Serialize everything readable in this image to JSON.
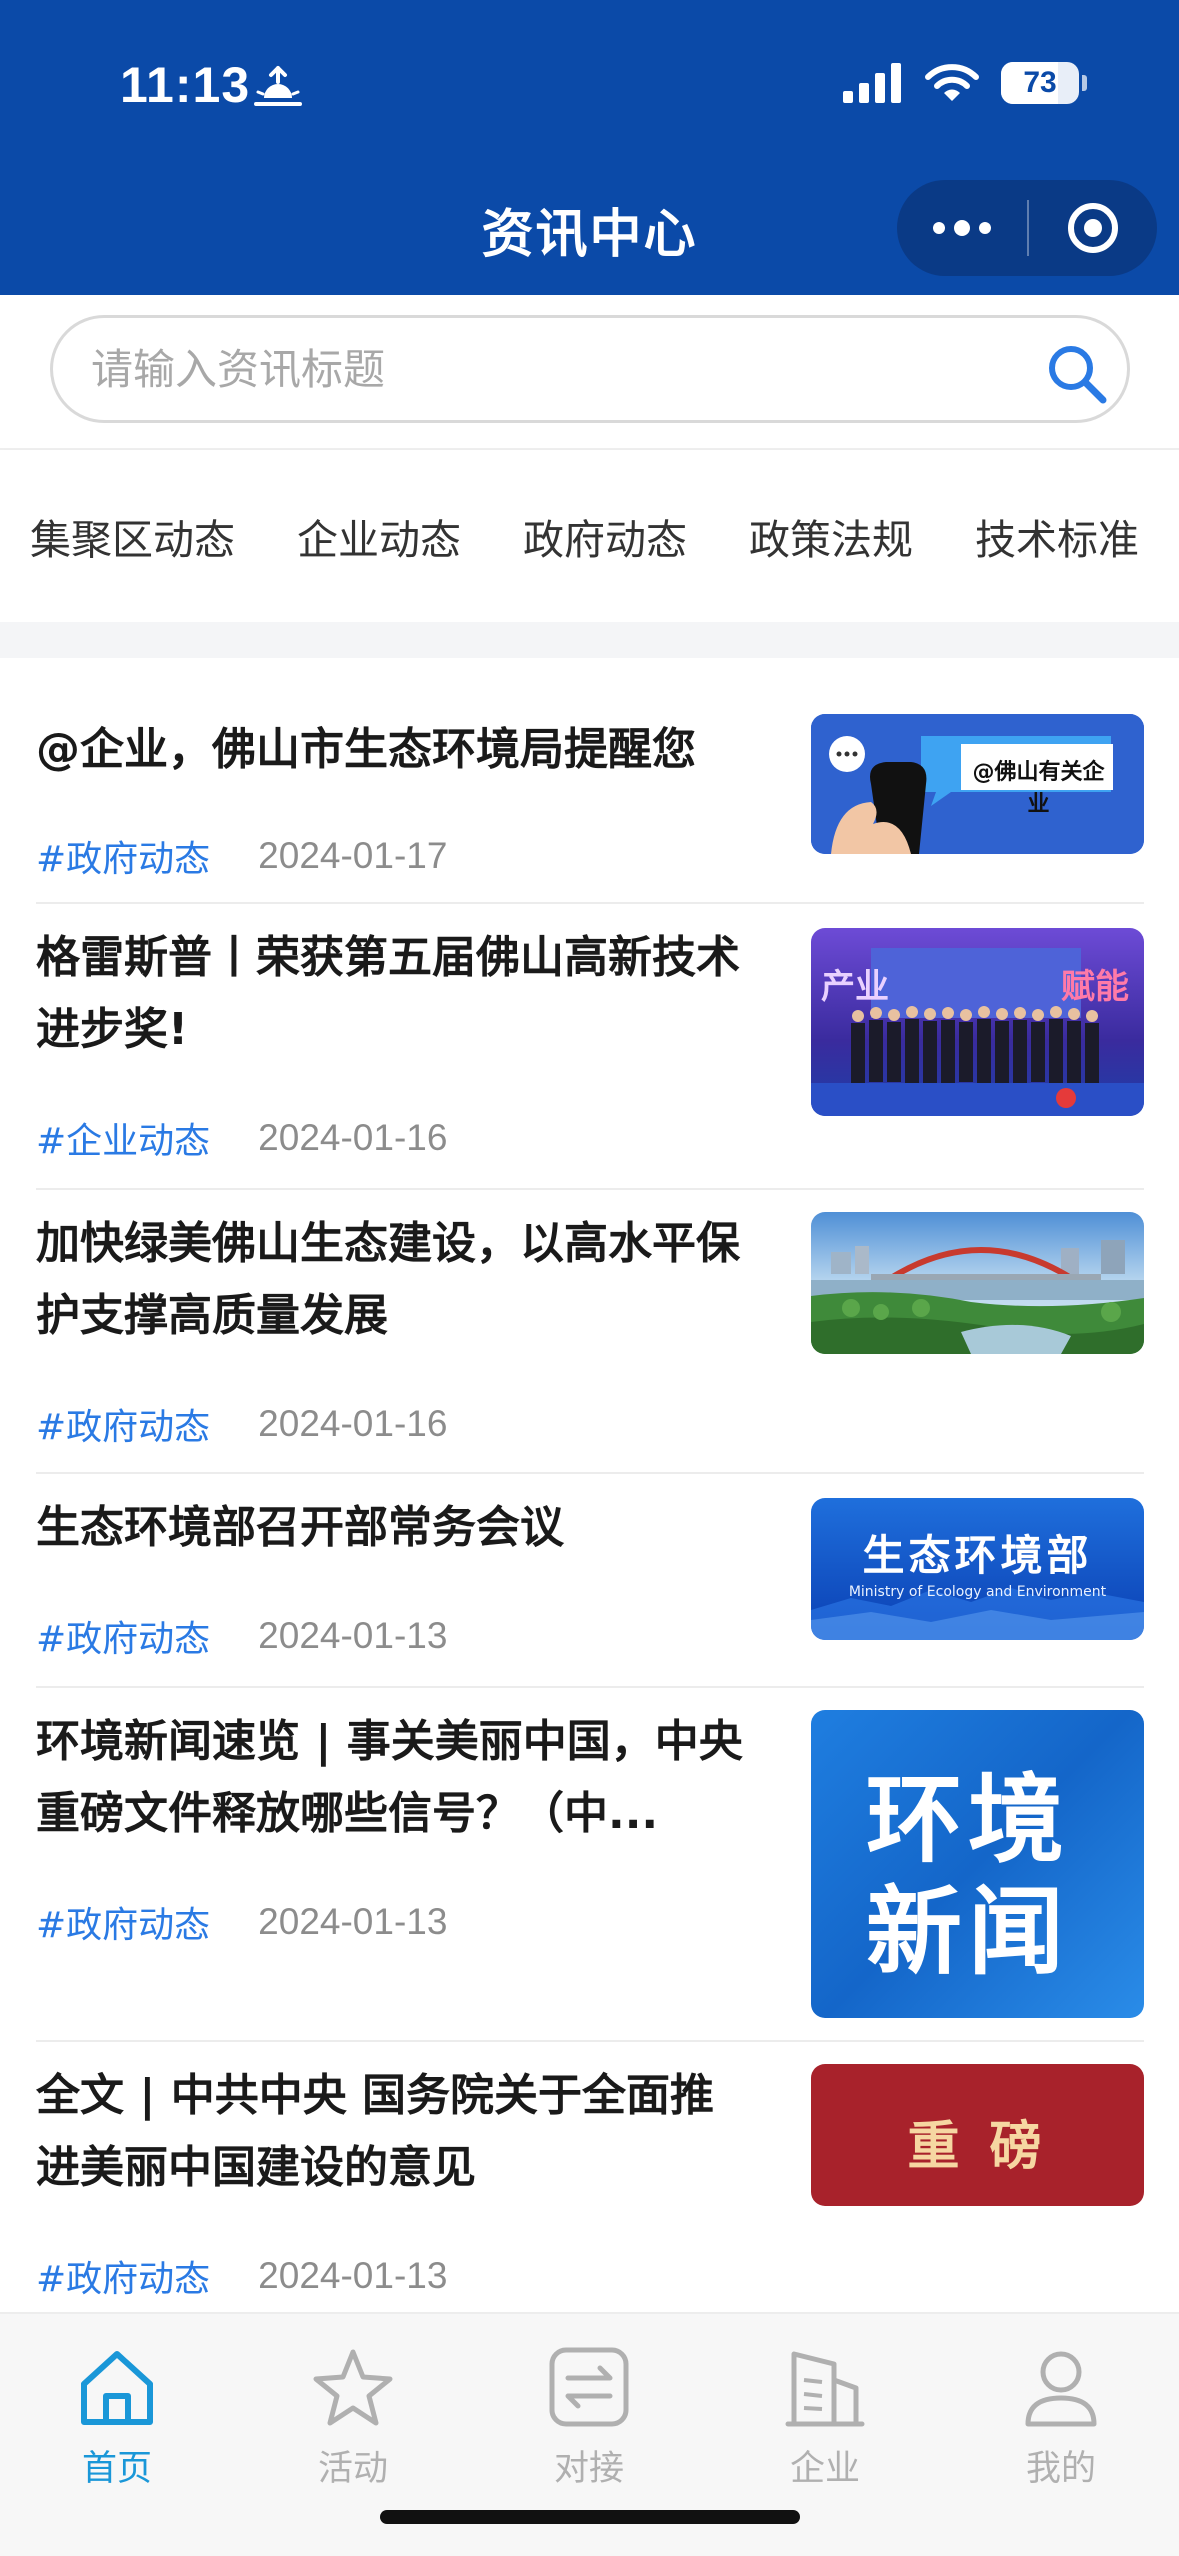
{
  "status_bar": {
    "time": "11:13",
    "battery": "73"
  },
  "nav": {
    "title": "资讯中心"
  },
  "search": {
    "placeholder": "请输入资讯标题"
  },
  "tabs": [
    "集聚区动态",
    "企业动态",
    "政府动态",
    "政策法规",
    "技术标准"
  ],
  "news": [
    {
      "title": "@企业，佛山市生态环境局提醒您",
      "tag": "#政府动态",
      "date": "2024-01-17",
      "thumb_text": "@佛山有关企业"
    },
    {
      "title": "格雷斯普丨荣获第五届佛山高新技术进步奖!",
      "tag": "#企业动态",
      "date": "2024-01-16",
      "thumb_text": ""
    },
    {
      "title": "加快绿美佛山生态建设，以高水平保护支撑高质量发展",
      "tag": "#政府动态",
      "date": "2024-01-16",
      "thumb_text": ""
    },
    {
      "title": "生态环境部召开部常务会议",
      "tag": "#政府动态",
      "date": "2024-01-13",
      "thumb_text": "生态环境部",
      "thumb_subtext": "Ministry of Ecology and Environment"
    },
    {
      "title": "环境新闻速览 | 事关美丽中国，中央重磅文件释放哪些信号？（中...",
      "tag": "#政府动态",
      "date": "2024-01-13",
      "thumb_text": "环境新闻"
    },
    {
      "title": "全文 | 中共中央 国务院关于全面推进美丽中国建设的意见",
      "tag": "#政府动态",
      "date": "2024-01-13",
      "thumb_text": "重 磅"
    }
  ],
  "tabbar": [
    {
      "label": "首页",
      "icon": "home-icon",
      "active": true
    },
    {
      "label": "活动",
      "icon": "star-icon",
      "active": false
    },
    {
      "label": "对接",
      "icon": "exchange-icon",
      "active": false
    },
    {
      "label": "企业",
      "icon": "building-icon",
      "active": false
    },
    {
      "label": "我的",
      "icon": "person-icon",
      "active": false
    }
  ],
  "colors": {
    "header": "#0b4aa8",
    "accent": "#2a7ae4",
    "tab_active": "#1a97d8"
  }
}
